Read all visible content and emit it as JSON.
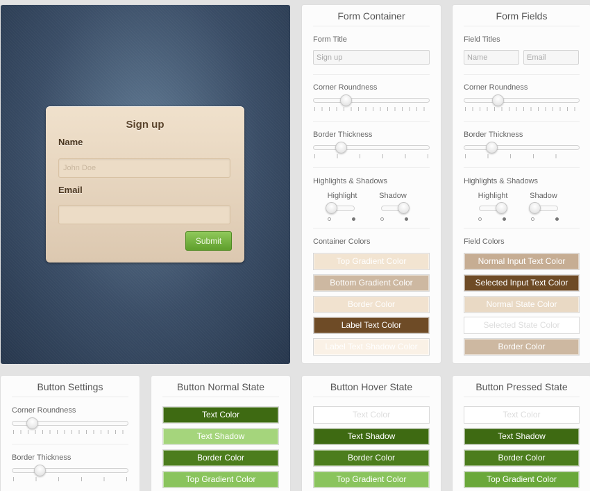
{
  "preview": {
    "form_title": "Sign up",
    "name_label": "Name",
    "name_placeholder": "John Doe",
    "email_label": "Email",
    "email_placeholder": "",
    "submit_label": "Submit"
  },
  "form_container": {
    "title": "Form Container",
    "form_title_label": "Form Title",
    "form_title_value": "Sign up",
    "corner_label": "Corner Roundness",
    "corner_value": 0.26,
    "border_label": "Border Thickness",
    "border_value": 0.21,
    "hs_label": "Highlights & Shadows",
    "highlight_label": "Highlight",
    "highlight_on": false,
    "shadow_label": "Shadow",
    "shadow_on": true,
    "colors_label": "Container Colors",
    "colors": [
      {
        "label": "Top Gradient Color",
        "bg": "#f2e4d1",
        "fg": "#ffffff"
      },
      {
        "label": "Bottom Gradient Color",
        "bg": "#cdb8a1",
        "fg": "#ffffff"
      },
      {
        "label": "Border Color",
        "bg": "#f1e2cf",
        "fg": "#ffffff"
      },
      {
        "label": "Label Text Color",
        "bg": "#6e4b26",
        "fg": "#ffffff"
      },
      {
        "label": "Label Text Shadow Color",
        "bg": "#faf1e6",
        "fg": "#ffffff"
      }
    ]
  },
  "form_fields": {
    "title": "Form Fields",
    "field_titles_label": "Field Titles",
    "field1_value": "Name",
    "field2_value": "Email",
    "corner_label": "Corner Roundness",
    "corner_value": 0.27,
    "border_label": "Border Thickness",
    "border_value": 0.21,
    "hs_label": "Highlights & Shadows",
    "highlight_label": "Highlight",
    "highlight_on": true,
    "shadow_label": "Shadow",
    "shadow_on": false,
    "colors_label": "Field Colors",
    "colors": [
      {
        "label": "Normal Input Text Color",
        "bg": "#c6ad93",
        "fg": "#ffffff"
      },
      {
        "label": "Selected Input Text Color",
        "bg": "#6e4b26",
        "fg": "#ffffff"
      },
      {
        "label": "Normal State Color",
        "bg": "#e9d9c4",
        "fg": "#ffffff"
      },
      {
        "label": "Selected State Color",
        "bg": "#ffffff",
        "fg": "#dddddd"
      },
      {
        "label": "Border Color",
        "bg": "#cdb8a1",
        "fg": "#ffffff"
      }
    ]
  },
  "button_settings": {
    "title": "Button Settings",
    "corner_label": "Corner Roundness",
    "corner_value": 0.14,
    "border_label": "Border Thickness",
    "border_value": 0.21
  },
  "button_normal": {
    "title": "Button Normal State",
    "colors": [
      {
        "label": "Text Color",
        "bg": "#3e6a12",
        "fg": "#ffffff"
      },
      {
        "label": "Text Shadow",
        "bg": "#a5d57c",
        "fg": "#ffffff"
      },
      {
        "label": "Border Color",
        "bg": "#4c7d1d",
        "fg": "#ffffff"
      },
      {
        "label": "Top Gradient Color",
        "bg": "#8ac45d",
        "fg": "#ffffff"
      }
    ]
  },
  "button_hover": {
    "title": "Button Hover State",
    "colors": [
      {
        "label": "Text Color",
        "bg": "#ffffff",
        "fg": "#dddddd"
      },
      {
        "label": "Text Shadow",
        "bg": "#3e6a12",
        "fg": "#ffffff"
      },
      {
        "label": "Border Color",
        "bg": "#4c7d1d",
        "fg": "#ffffff"
      },
      {
        "label": "Top Gradient Color",
        "bg": "#8ac45d",
        "fg": "#ffffff"
      }
    ]
  },
  "button_pressed": {
    "title": "Button Pressed State",
    "colors": [
      {
        "label": "Text Color",
        "bg": "#ffffff",
        "fg": "#dddddd"
      },
      {
        "label": "Text Shadow",
        "bg": "#3e6a12",
        "fg": "#ffffff"
      },
      {
        "label": "Border Color",
        "bg": "#4c7d1d",
        "fg": "#ffffff"
      },
      {
        "label": "Top Gradient Color",
        "bg": "#6aa83a",
        "fg": "#ffffff"
      }
    ]
  }
}
